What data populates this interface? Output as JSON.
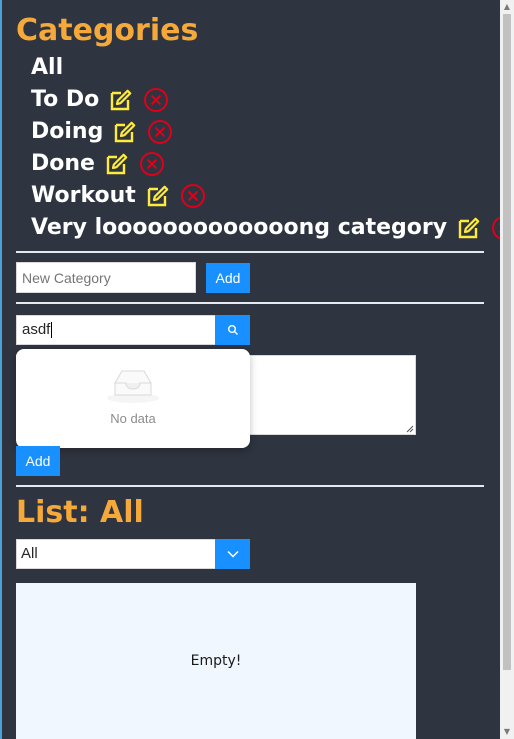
{
  "categories": {
    "title": "Categories",
    "items": [
      {
        "label": "All",
        "editable": false
      },
      {
        "label": "To Do",
        "editable": true
      },
      {
        "label": "Doing",
        "editable": true
      },
      {
        "label": "Done",
        "editable": true
      },
      {
        "label": "Workout",
        "editable": true
      },
      {
        "label": "Very looooooooooooong category",
        "editable": true
      }
    ],
    "new_placeholder": "New Category",
    "add_label": "Add"
  },
  "search": {
    "value": "asdf",
    "dropdown_empty_text": "No data"
  },
  "task": {
    "add_label": "Add"
  },
  "list": {
    "title": "List: All",
    "filter_value": "All",
    "empty_text": "Empty!"
  },
  "colors": {
    "background": "#2e3440",
    "heading": "#f5a93b",
    "edit_icon": "#ffeb3b",
    "delete_icon": "#e0001a",
    "primary": "#1890ff"
  },
  "icons": [
    "edit-icon",
    "delete-icon",
    "search-icon",
    "chevron-down-icon",
    "empty-inbox-icon"
  ]
}
